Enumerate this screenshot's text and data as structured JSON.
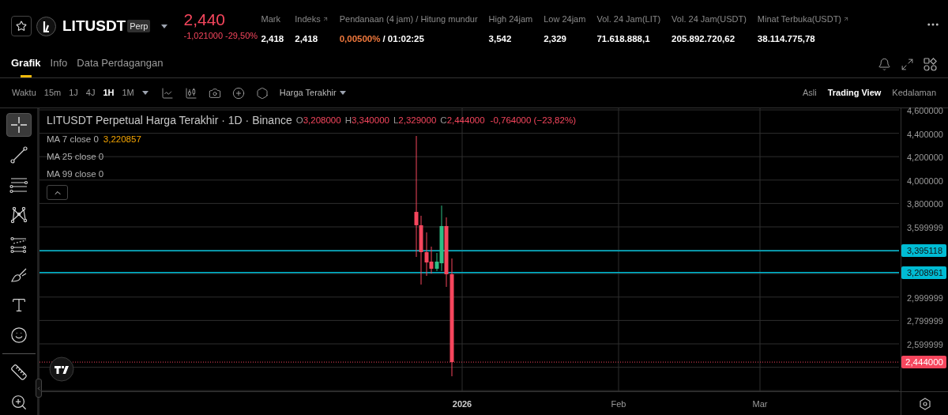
{
  "header": {
    "symbol": "LITUSDT",
    "badge": "Perp",
    "price": "2,440",
    "change": "-1,021000",
    "change_pct": "-29,50%",
    "stats": [
      {
        "kind": "plain",
        "label": "Mark",
        "external": false,
        "value": "2,418"
      },
      {
        "kind": "plain",
        "label": "Indeks",
        "external": true,
        "value": "2,418"
      },
      {
        "kind": "funding",
        "label": "Pendanaan (4 jam) / Hitung mundur",
        "external": false,
        "rate": "0,00500%",
        "countdown": "/ 01:02:25"
      },
      {
        "kind": "plain",
        "label": "High 24jam",
        "external": false,
        "value": "3,542"
      },
      {
        "kind": "plain",
        "label": "Low 24jam",
        "external": false,
        "value": "2,329"
      },
      {
        "kind": "plain",
        "label": "Vol. 24 Jam(LIT)",
        "external": false,
        "value": "71.618.888,1"
      },
      {
        "kind": "plain",
        "label": "Vol. 24 Jam(USDT)",
        "external": false,
        "value": "205.892.720,62"
      },
      {
        "kind": "plain",
        "label": "Minat Terbuka(USDT)",
        "external": true,
        "value": "38.114.775,78"
      }
    ]
  },
  "tabs": [
    {
      "label": "Grafik",
      "selected": true
    },
    {
      "label": "Info",
      "selected": false
    },
    {
      "label": "Data Perdagangan",
      "selected": false
    }
  ],
  "toolbar": {
    "label": "Waktu",
    "intervals": [
      {
        "label": "15m",
        "selected": false
      },
      {
        "label": "1J",
        "selected": false
      },
      {
        "label": "4J",
        "selected": false
      },
      {
        "label": "1H",
        "selected": true
      },
      {
        "label": "1M",
        "selected": false
      }
    ],
    "price_type": "Harga Terakhir",
    "views": [
      {
        "label": "Asli",
        "selected": false
      },
      {
        "label": "Trading View",
        "selected": true
      },
      {
        "label": "Kedalaman",
        "selected": false
      }
    ]
  },
  "drawing_tools": [
    {
      "kind": "crosshair",
      "selected": true
    },
    {
      "kind": "trend-line",
      "selected": false
    },
    {
      "kind": "lines",
      "selected": false
    },
    {
      "kind": "pattern",
      "selected": false
    },
    {
      "kind": "fib",
      "selected": false
    },
    {
      "kind": "brush",
      "selected": false
    },
    {
      "kind": "text",
      "selected": false
    },
    {
      "kind": "emoji",
      "selected": false
    }
  ],
  "measure_tools": [
    {
      "kind": "ruler",
      "selected": false
    },
    {
      "kind": "zoom",
      "selected": false
    }
  ],
  "chart": {
    "title": "LITUSDT Perpetual Harga Terakhir · 1D · Binance",
    "ohlc": [
      {
        "key": "O",
        "value": "3,208000"
      },
      {
        "key": "H",
        "value": "3,340000"
      },
      {
        "key": "L",
        "value": "2,329000"
      },
      {
        "key": "C",
        "value": "2,444000"
      }
    ],
    "change": "-0,764000 (−23,82%)",
    "indicators": [
      {
        "label": "MA 7 close 0",
        "value": "3,220857"
      },
      {
        "label": "MA 25 close 0"
      },
      {
        "label": "MA 99 close 0"
      }
    ],
    "price_axis": [
      "4,600000",
      "4,400000",
      "4,200000",
      "4,000000",
      "3,800000",
      "3,599999",
      "2,999999",
      "2,799999",
      "2,599999"
    ],
    "lines": [
      {
        "label": "3,395118",
        "color": "#00bcd4"
      },
      {
        "label": "3,208961",
        "color": "#00bcd4"
      }
    ],
    "last_price": "2,444000",
    "time_axis": [
      "2026",
      "Feb",
      "Mar"
    ]
  }
}
